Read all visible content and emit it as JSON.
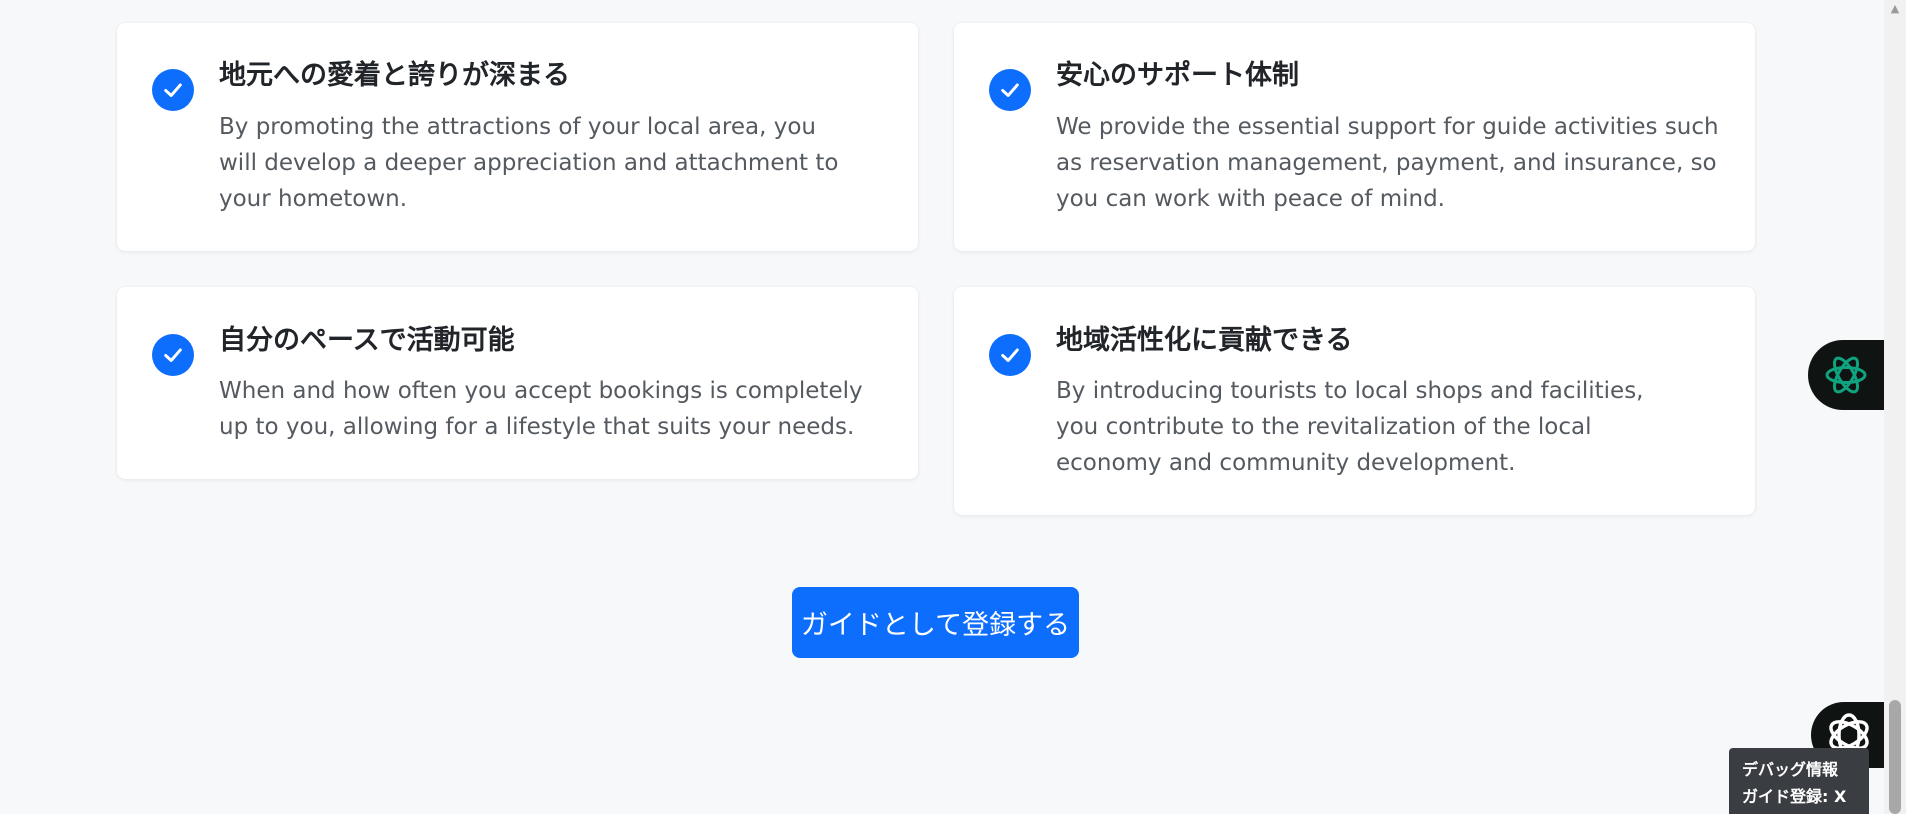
{
  "benefits": [
    {
      "title": "地元への愛着と誇りが深まる",
      "description": "By promoting the attractions of your local area, you will develop a deeper appreciation and attachment to your hometown."
    },
    {
      "title": "安心のサポート体制",
      "description": "We provide the essential support for guide activities such as reservation management, payment, and insurance, so you can work with peace of mind."
    },
    {
      "title": "自分のペースで活動可能",
      "description": "When and how often you accept bookings is completely up to you, allowing for a lifestyle that suits your needs."
    },
    {
      "title": "地域活性化に貢献できる",
      "description": "By introducing tourists to local shops and facilities, you contribute to the revitalization of the local economy and community development."
    }
  ],
  "cta": {
    "label": "ガイドとして登録する"
  },
  "debug": {
    "title": "デバッグ情報",
    "line": "ガイド登録: X"
  },
  "colors": {
    "accent": "#0d6efd",
    "chat_fab": "#0f1412",
    "ai_icon": "#10a37f"
  },
  "icons": {
    "benefit": "check-circle-icon",
    "chat_fab": "ai-assistant-icon",
    "chatgpt_fab": "chatgpt-icon"
  }
}
